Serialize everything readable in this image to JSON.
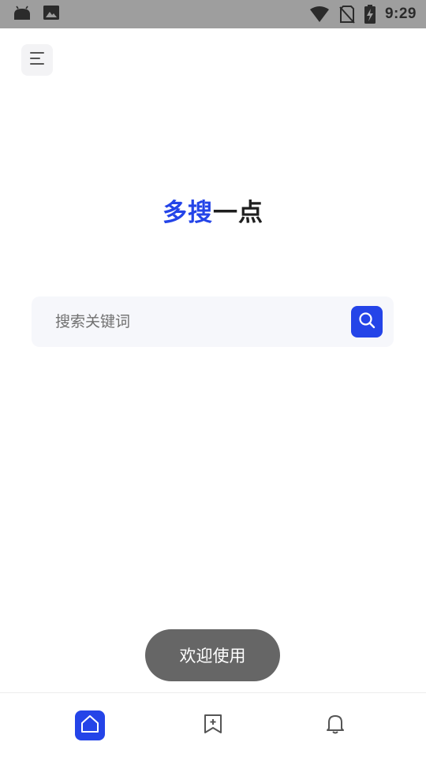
{
  "status_bar": {
    "time": "9:29",
    "icons": [
      "android-icon",
      "image-icon",
      "wifi-icon",
      "no-sim-icon",
      "battery-charging-icon"
    ]
  },
  "header": {
    "menu_icon": "menu-icon"
  },
  "logo": {
    "part_a": "多搜",
    "part_b": "一点"
  },
  "search": {
    "placeholder": "搜索关键词",
    "value": "",
    "button_icon": "search-icon"
  },
  "toast": {
    "text": "欢迎使用"
  },
  "bottom_nav": {
    "items": [
      {
        "icon": "home-icon",
        "active": true
      },
      {
        "icon": "bookmark-add-icon",
        "active": false
      },
      {
        "icon": "bell-icon",
        "active": false
      }
    ]
  },
  "colors": {
    "accent": "#2444e8",
    "status_bar": "#9e9e9e",
    "search_bg": "#f6f7fb",
    "toast_bg": "#666666",
    "logo_dark": "#1e1e1e"
  }
}
